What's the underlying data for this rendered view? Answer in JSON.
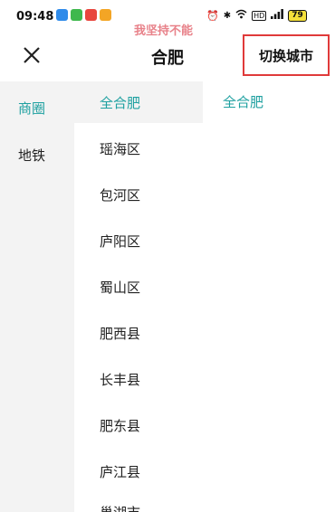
{
  "status_bar": {
    "time": "09:48",
    "watermark": "我坚持不能",
    "battery": "79"
  },
  "header": {
    "title": "合肥",
    "switch_city": "切换城市"
  },
  "left_menu": [
    "商圈",
    "地铁"
  ],
  "districts": [
    "全合肥",
    "瑶海区",
    "包河区",
    "庐阳区",
    "蜀山区",
    "肥西县",
    "长丰县",
    "肥东县",
    "庐江县",
    "巢湖市"
  ],
  "right_panel": {
    "selected": "全合肥"
  },
  "colors": {
    "accent": "#1ea0a0",
    "highlight_border": "#e03a3a"
  }
}
